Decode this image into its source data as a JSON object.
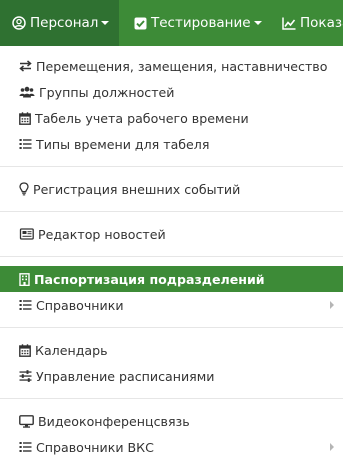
{
  "navbar": {
    "items": [
      {
        "label": "Персонал",
        "icon": "user-circle-icon",
        "active": true
      },
      {
        "label": "Тестирование",
        "icon": "checkbox-icon",
        "active": false
      },
      {
        "label": "Показа",
        "icon": "line-chart-icon",
        "active": false
      }
    ]
  },
  "menu": {
    "items": [
      {
        "label": "Перемещения, замещения, наставничество",
        "icon": "exchange-icon"
      },
      {
        "label": "Группы должностей",
        "icon": "users-icon"
      },
      {
        "label": "Табель учета рабочего времени",
        "icon": "calendar-icon"
      },
      {
        "label": "Типы времени для табеля",
        "icon": "list-icon"
      },
      {
        "label": "Регистрация внешних событий",
        "icon": "lightbulb-icon"
      },
      {
        "label": "Редактор новостей",
        "icon": "newspaper-icon"
      },
      {
        "label": "Паспортизация подразделений",
        "icon": "building-icon"
      },
      {
        "label": "Справочники",
        "icon": "list-icon"
      },
      {
        "label": "Календарь",
        "icon": "calendar-icon"
      },
      {
        "label": "Управление расписаниями",
        "icon": "sliders-icon"
      },
      {
        "label": "Видеоконференцсвязь",
        "icon": "desktop-icon"
      },
      {
        "label": "Справочники ВКС",
        "icon": "list-icon"
      }
    ]
  },
  "colors": {
    "navbar": "#3d8b37",
    "navbar_active": "#2f7131",
    "highlight": "#3d8b37",
    "text": "#333333"
  }
}
